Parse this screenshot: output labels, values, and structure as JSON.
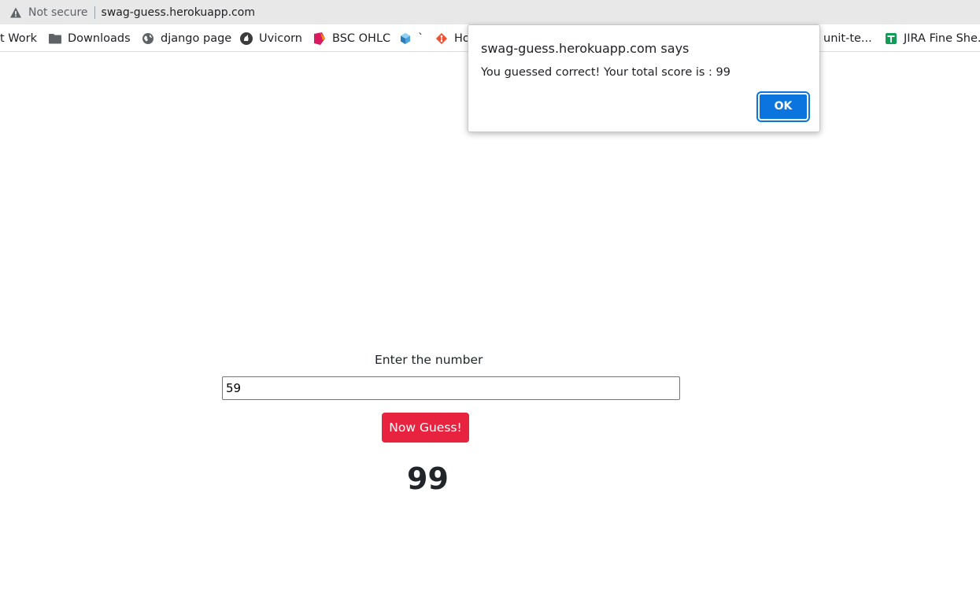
{
  "browser": {
    "security_label": "Not secure",
    "url": "swag-guess.herokuapp.com"
  },
  "bookmarks": [
    {
      "label": "t Work",
      "icon": "none"
    },
    {
      "label": "Downloads",
      "icon": "folder-icon"
    },
    {
      "label": "django page",
      "icon": "globe-icon"
    },
    {
      "label": "Uvicorn",
      "icon": "unicorn-icon"
    },
    {
      "label": "BSC OHLC",
      "icon": "bsc-icon"
    },
    {
      "label": "`",
      "icon": "cube-icon"
    },
    {
      "label": "Ho",
      "icon": "git-icon"
    },
    {
      "label": "unit-te...",
      "icon": "none"
    },
    {
      "label": "JIRA Fine She...",
      "icon": "sheets-icon"
    }
  ],
  "dialog": {
    "title": "swag-guess.herokuapp.com says",
    "message": "You guessed correct! Your total score is : 99",
    "ok_label": "OK"
  },
  "form": {
    "prompt": "Enter the number",
    "input_value": "59",
    "button_label": "Now Guess!"
  },
  "score": "99",
  "colors": {
    "button": "#e8233f",
    "dialog_ok": "#0b74de"
  }
}
